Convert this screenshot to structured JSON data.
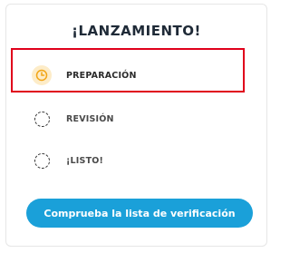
{
  "header": {
    "title": "¡LANZAMIENTO!"
  },
  "steps": [
    {
      "label": "PREPARACIÓN",
      "icon": "clock-icon",
      "state": "active"
    },
    {
      "label": "REVISIÓN",
      "icon": "dashed-circle-icon",
      "state": "pending"
    },
    {
      "label": "¡LISTO!",
      "icon": "dashed-circle-icon",
      "state": "pending"
    }
  ],
  "cta": {
    "label": "Comprueba la lista de verificación"
  },
  "colors": {
    "accent": "#1aa0d9",
    "highlight": "#e0001b",
    "active_icon_bg": "#fdecc8",
    "active_icon": "#f2a516"
  }
}
